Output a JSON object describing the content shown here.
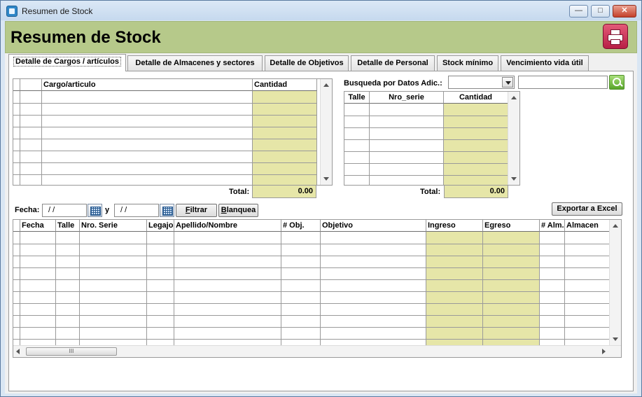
{
  "window": {
    "title": "Resumen de Stock"
  },
  "header": {
    "title": "Resumen de Stock"
  },
  "tabs": [
    {
      "label": "Detalle de Cargos / artículos",
      "active": true
    },
    {
      "label": "Detalle de Almacenes y sectores"
    },
    {
      "label": "Detalle de Objetivos"
    },
    {
      "label": "Detalle de Personal"
    },
    {
      "label": "Stock mínimo"
    },
    {
      "label": "Vencimiento vida útil"
    }
  ],
  "cargos_grid": {
    "columns": [
      "Cargo/articulo",
      "Cantidad"
    ],
    "total_label": "Total:",
    "total_value": "0.00"
  },
  "busqueda": {
    "label": "Busqueda por Datos Adic.:",
    "combo_value": "",
    "text_value": ""
  },
  "talle_grid": {
    "columns": [
      "Talle",
      "Nro_serie",
      "Cantidad"
    ],
    "total_label": "Total:",
    "total_value": "0.00"
  },
  "filter": {
    "fecha_label": "Fecha:",
    "from_date": "/ /",
    "and_label": "y",
    "to_date": "/ /",
    "filtrar_first": "F",
    "filtrar_rest": "iltrar",
    "blanquea_first": "B",
    "blanquea_rest": "lanquea",
    "export_label": "Exportar a Excel"
  },
  "movements_grid": {
    "columns": [
      "Fecha",
      "Talle",
      "Nro. Serie",
      "Legajo",
      "Apellido/Nombre",
      "# Obj.",
      "Objetivo",
      "Ingreso",
      "Egreso",
      "# Alm.",
      "Almacen"
    ],
    "scroll_thumb": "III"
  },
  "colors": {
    "header_band": "#b6c98a",
    "qty_column": "#e6e6a8"
  }
}
